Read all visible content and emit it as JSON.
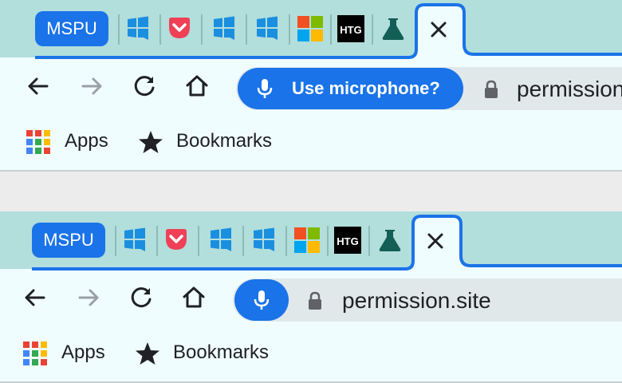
{
  "colors": {
    "tabstrip": "#b2dedc",
    "toolbar": "#f0fdff",
    "accent": "#1a73e8",
    "active_tab_border": "#1a73e8"
  },
  "tabs": [
    {
      "name": "MSPU",
      "icon": "mspu-badge"
    },
    {
      "icon": "windows-bubble-icon"
    },
    {
      "icon": "pocket-icon"
    },
    {
      "icon": "windows-bubble-icon"
    },
    {
      "icon": "windows-bubble-icon"
    },
    {
      "icon": "microsoft-logo-icon"
    },
    {
      "name": "HTG",
      "icon": "htg-logo"
    },
    {
      "icon": "flask-icon"
    },
    {
      "icon": "close-icon",
      "active": true
    }
  ],
  "toolbar": {
    "buttons": [
      "back-icon",
      "forward-icon",
      "reload-icon",
      "home-icon"
    ]
  },
  "top": {
    "mic_chip_label": "Use microphone?",
    "url": "permission.site"
  },
  "bottom": {
    "url": "permission.site"
  },
  "bookmarks_bar": {
    "apps_label": "Apps",
    "bookmarks_label": "Bookmarks"
  }
}
